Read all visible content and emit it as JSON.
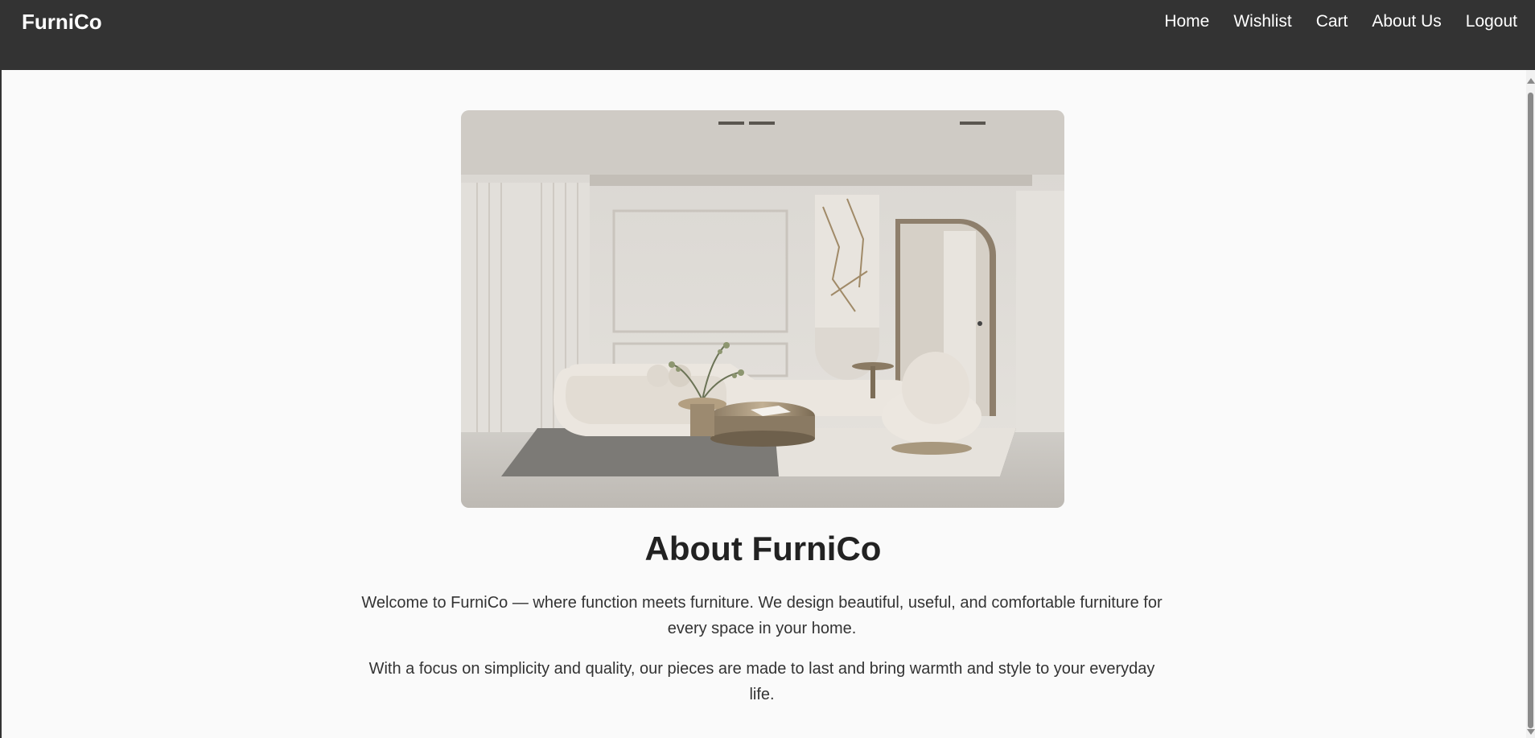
{
  "navbar": {
    "brand": "FurniCo",
    "links": [
      "Home",
      "Wishlist",
      "Cart",
      "About Us",
      "Logout"
    ]
  },
  "about": {
    "title": "About FurniCo",
    "paragraph1": "Welcome to FurniCo — where function meets furniture. We design beautiful, useful, and comfortable furniture for every space in your home.",
    "paragraph2": "With a focus on simplicity and quality, our pieces are made to last and bring warmth and style to your everyday life."
  },
  "colors": {
    "navbar_bg": "#333333",
    "page_bg": "#fafafa",
    "text_dark": "#222222"
  }
}
